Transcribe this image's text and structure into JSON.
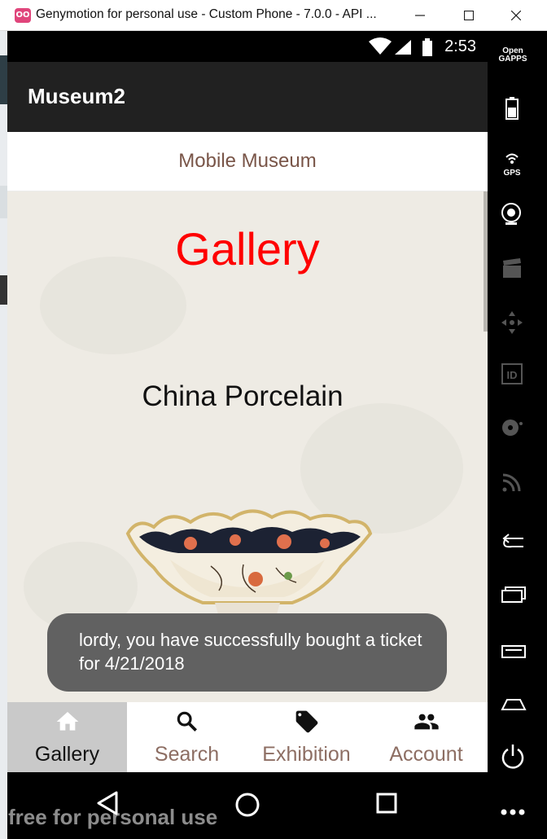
{
  "window": {
    "title": "Genymotion for personal use - Custom Phone - 7.0.0 - API ...",
    "logo_text": "OO",
    "watermark": "free for personal use"
  },
  "status_bar": {
    "time": "2:53"
  },
  "app_bar": {
    "title": "Museum2"
  },
  "subheader": {
    "text": "Mobile Museum"
  },
  "content": {
    "heading": "Gallery",
    "item_title": "China Porcelain"
  },
  "toast": {
    "message": "lordy, you have successfully bought a ticket for 4/21/2018"
  },
  "bottom_nav": {
    "items": [
      {
        "label": "Gallery",
        "icon": "home-icon",
        "active": true
      },
      {
        "label": "Search",
        "icon": "search-icon",
        "active": false
      },
      {
        "label": "Exhibition",
        "icon": "tag-icon",
        "active": false
      },
      {
        "label": "Account",
        "icon": "people-icon",
        "active": false
      }
    ]
  },
  "sidebar": {
    "open_gapps": "Open GAPPS",
    "gps_label": "GPS",
    "id_label": "ID",
    "buttons": [
      "battery",
      "gps",
      "webcam",
      "capture",
      "navigation",
      "identifiers",
      "disk",
      "cast",
      "back",
      "recent-apps",
      "menu",
      "home",
      "power",
      "more"
    ]
  },
  "colors": {
    "heading": "#ff0000",
    "subheader": "#795548",
    "nav_inactive": "#8d6e63",
    "app_bar": "#212121",
    "toast": "#616161"
  }
}
